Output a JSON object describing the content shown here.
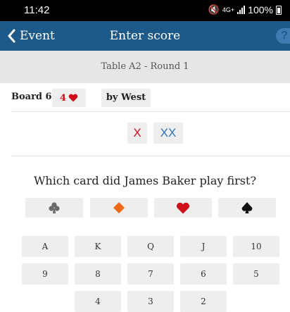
{
  "status_bar": {
    "time": "11:42",
    "network": "4G+",
    "battery": "100%",
    "icons": [
      "mute-icon",
      "signal-icon",
      "battery-icon"
    ]
  },
  "header": {
    "back_label": "Event",
    "title": "Enter score",
    "help_label": "?"
  },
  "table_info": "Table A2  -  Round 1",
  "board": {
    "label": "Board 6",
    "contract_level": "4",
    "contract_suit": "heart-icon",
    "declarer": "by West"
  },
  "double_buttons": {
    "double": "X",
    "redouble": "XX"
  },
  "question": "Which card did James Baker play first?",
  "suits": [
    {
      "name": "clubs",
      "icon": "club-icon",
      "color": "#6b6b6b"
    },
    {
      "name": "diamonds",
      "icon": "diamond-icon",
      "color": "#ee6a1a"
    },
    {
      "name": "hearts",
      "icon": "heart-icon",
      "color": "#d10f1b"
    },
    {
      "name": "spades",
      "icon": "spade-icon",
      "color": "#111111"
    }
  ],
  "ranks": [
    "A",
    "K",
    "Q",
    "J",
    "10",
    "9",
    "8",
    "7",
    "6",
    "5",
    "4",
    "3",
    "2"
  ],
  "colors": {
    "header": "#1d5a8a",
    "red": "#d10f1b",
    "blue": "#2a74b4",
    "button_bg": "#eeeeee"
  }
}
